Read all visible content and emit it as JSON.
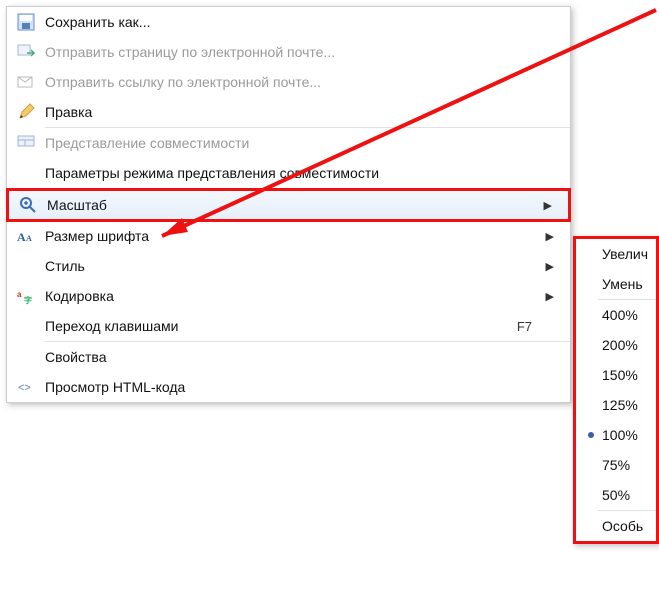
{
  "menu": {
    "save_as": "Сохранить как...",
    "send_page_email": "Отправить страницу по электронной почте...",
    "send_link_email": "Отправить ссылку по электронной почте...",
    "edit": "Правка",
    "compat_view": "Представление совместимости",
    "compat_view_settings": "Параметры режима представления совместимости",
    "zoom": "Масштаб",
    "font_size": "Размер шрифта",
    "style": "Стиль",
    "encoding": "Кодировка",
    "caret_browsing": "Переход клавишами",
    "caret_shortcut": "F7",
    "properties": "Свойства",
    "view_source": "Просмотр HTML-кода"
  },
  "submenu": {
    "zoom_in": "Увелич",
    "zoom_out": "Умень",
    "z400": "400%",
    "z200": "200%",
    "z150": "150%",
    "z125": "125%",
    "z100": "100%",
    "z75": "75%",
    "z50": "50%",
    "custom": "Особь"
  },
  "colors": {
    "highlight": "#e11"
  }
}
